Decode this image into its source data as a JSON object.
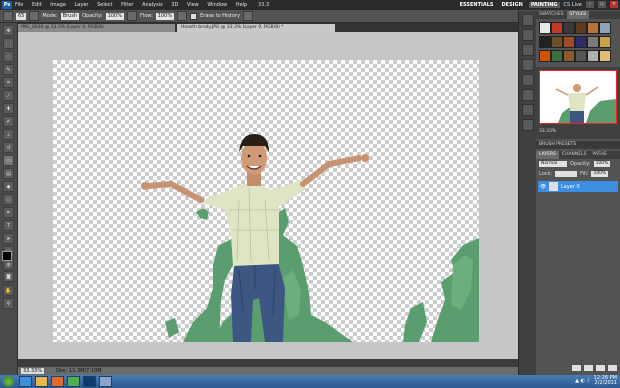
{
  "app": {
    "logo": "Ps",
    "menu": [
      "File",
      "Edit",
      "Image",
      "Layer",
      "Select",
      "Filter",
      "Analysis",
      "3D",
      "View",
      "Window",
      "Help"
    ],
    "zoom_field": "33.3",
    "workspaces": [
      "ESSENTIALS",
      "DESIGN",
      "PAINTING"
    ],
    "active_workspace": "PAINTING",
    "cs_live": "CS Live"
  },
  "options": {
    "brush_size": "65",
    "mode_label": "Mode:",
    "mode_value": "Brush",
    "opacity_label": "Opacity:",
    "opacity_value": "100%",
    "flow_label": "Flow:",
    "flow_value": "100%",
    "erase_to_history": "Erase to History"
  },
  "tabs": [
    {
      "label": "IMG_0036 @ 33.3% (Layer 0, RGB/8)",
      "active": false
    },
    {
      "label": "Heasth brody.JPG @ 33.3% (Layer 0, RGB/8) *",
      "active": true
    }
  ],
  "status": {
    "zoom": "33.33%",
    "doc": "Doc: 11.3M/7.10M"
  },
  "panels": {
    "swatches_tab": "SWATCHES",
    "styles_tab": "STYLES",
    "styles": [
      "#e8e8e8",
      "#c0392b",
      "#3a3a3a",
      "#5c3b1e",
      "#b87333",
      "#8fa3b8",
      "#222222",
      "#6b4e2e",
      "#a14b2a",
      "#2d2d6b",
      "#7a7a7a",
      "#c9a34a",
      "#d35400",
      "#3a6e3a",
      "#8e5a2a",
      "#555555",
      "#b0b0b0",
      "#e0c070"
    ],
    "navigator_zoom": "33.33%",
    "brush_presets": "BRUSH PRESETS",
    "layers_tab": "LAYERS",
    "channels_tab": "CHANNELS",
    "paths_tab": "PATHS",
    "blend_mode": "Normal",
    "opacity_label": "Opacity:",
    "opacity_value": "100%",
    "lock_label": "Lock:",
    "fill_label": "Fill:",
    "fill_value": "100%",
    "layer_name": "Layer 0"
  },
  "taskbar": {
    "time": "12:26 PM",
    "date": "2/2/2011"
  },
  "colors": {
    "accent": "#3c8fe0",
    "green": "#5a9e6f",
    "shirt": "#dfe5c4",
    "jeans": "#3d5782"
  }
}
